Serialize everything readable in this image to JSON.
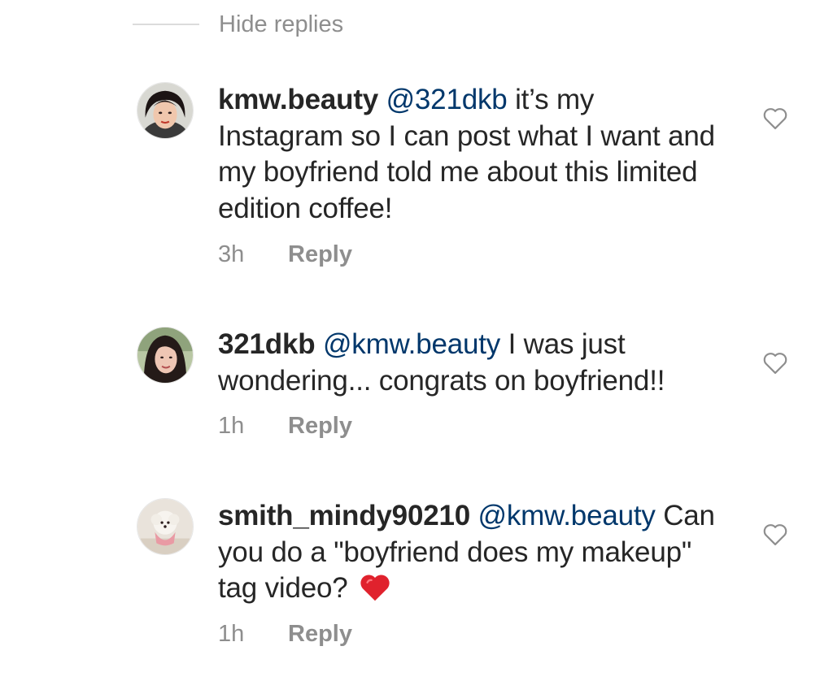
{
  "hide_replies_label": "Hide replies",
  "comments": [
    {
      "username": "kmw.beauty",
      "mention": "@321dkb",
      "text": " it’s my Instagram so I can post what I want and my boyfriend told me about this limited edition coffee!",
      "time": "3h",
      "reply_label": "Reply",
      "like_icon": "heart-outline-icon"
    },
    {
      "username": "321dkb",
      "mention": "@kmw.beauty",
      "text": " I was just wondering... congrats on boyfriend!!",
      "time": "1h",
      "reply_label": "Reply",
      "like_icon": "heart-outline-icon"
    },
    {
      "username": "smith_mindy90210",
      "mention": "@kmw.beauty",
      "text": " Can you do a \"boyfriend does my makeup\" tag video?",
      "emoji": "red-heart-emoji",
      "time": "1h",
      "reply_label": "Reply",
      "like_icon": "heart-outline-icon"
    }
  ],
  "colors": {
    "text": "#262626",
    "secondary": "#8e8e8e",
    "mention": "#00376b",
    "divider": "#dbdbdb",
    "emoji_heart": "#e0222d"
  }
}
